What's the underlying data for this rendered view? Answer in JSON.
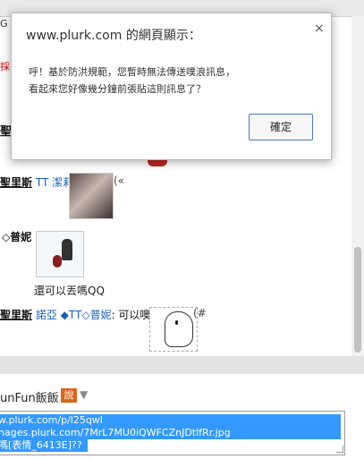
{
  "background": {
    "strip_g": "G",
    "strip_red": "採",
    "partial_name": "聖里斯",
    "post1": {
      "author": "聖里斯",
      "target": "TT 潔莉",
      "sep": ":",
      "tail": "(«"
    },
    "post2": {
      "author": "◇普妮",
      "caption": "還可以丟嗎QQ"
    },
    "post3": {
      "author": "聖里斯",
      "targets": "諾亞 ◆TT◇普妮",
      "text": ": 可以噢！",
      "tail": "(#"
    }
  },
  "composer": {
    "label": "unFun飯飯",
    "say": "說",
    "arrow": "▼",
    "lines": [
      "w.plurk.com/p/l25qwl",
      "nages.plurk.com/7MrL7MU0iQWFCZnJDtlfRr.jpg",
      "嗎[表情_6413E]??"
    ]
  },
  "dialog": {
    "title": "www.plurk.com 的網頁顯示：",
    "close": "×",
    "message_line1": "呼！基於防洪規範，您暫時無法傳送噗浪訊息，",
    "message_line2": "看起來您好像幾分鐘前張貼這則訊息了？",
    "ok_label": "確定"
  },
  "colors": {
    "accent": "#4a78c2",
    "selection": "#3399ff",
    "say_badge": "#d9651b",
    "link": "#1a5fb4"
  }
}
